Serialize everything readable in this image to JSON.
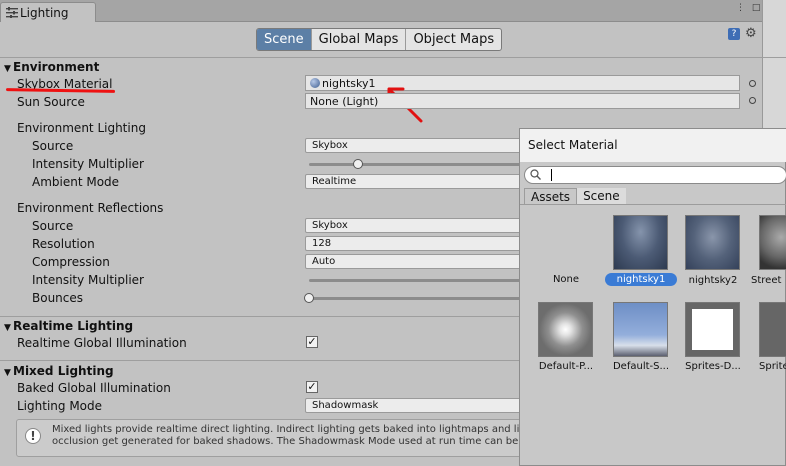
{
  "window": {
    "title": "Lighting"
  },
  "toolbar": {
    "tabs": [
      "Scene",
      "Global Maps",
      "Object Maps"
    ],
    "active": "Scene"
  },
  "environment": {
    "header": "Environment",
    "skybox_label": "Skybox Material",
    "skybox_value": "nightsky1",
    "sun_label": "Sun Source",
    "sun_value": "None (Light)",
    "env_lighting_header": "Environment Lighting",
    "source_label": "Source",
    "source_value": "Skybox",
    "intensity_label": "Intensity Multiplier",
    "intensity_value": 0.23,
    "ambient_label": "Ambient Mode",
    "ambient_value": "Realtime",
    "env_reflections_header": "Environment Reflections",
    "refl_source_label": "Source",
    "refl_source_value": "Skybox",
    "resolution_label": "Resolution",
    "resolution_value": "128",
    "compression_label": "Compression",
    "compression_value": "Auto",
    "refl_intensity_label": "Intensity Multiplier",
    "bounces_label": "Bounces",
    "bounces_value": 0
  },
  "realtime": {
    "header": "Realtime Lighting",
    "gi_label": "Realtime Global Illumination",
    "gi_checked": true
  },
  "mixed": {
    "header": "Mixed Lighting",
    "baked_label": "Baked Global Illumination",
    "baked_checked": true,
    "mode_label": "Lighting Mode",
    "mode_value": "Shadowmask",
    "help_text": "Mixed lights provide realtime direct lighting. Indirect lighting gets baked into lightmaps and li occlusion get generated for baked shadows. The Shadowmask Mode used at run time can be s"
  },
  "popup": {
    "title": "Select Material",
    "search_value": "",
    "tabs": [
      "Assets",
      "Scene"
    ],
    "active_tab": "Scene",
    "items": [
      {
        "label": "None",
        "selected": false
      },
      {
        "label": "nightsky1",
        "selected": true
      },
      {
        "label": "nightsky2",
        "selected": false
      },
      {
        "label": "Street",
        "selected": false
      },
      {
        "label": "Default-P...",
        "selected": false
      },
      {
        "label": "Default-S...",
        "selected": false
      },
      {
        "label": "Sprites-D...",
        "selected": false
      },
      {
        "label": "Sprite",
        "selected": false
      }
    ]
  },
  "colors": {
    "accent": "#3a7bd5",
    "annotation": "#e11111",
    "active_tab": "#5c7fa6"
  }
}
